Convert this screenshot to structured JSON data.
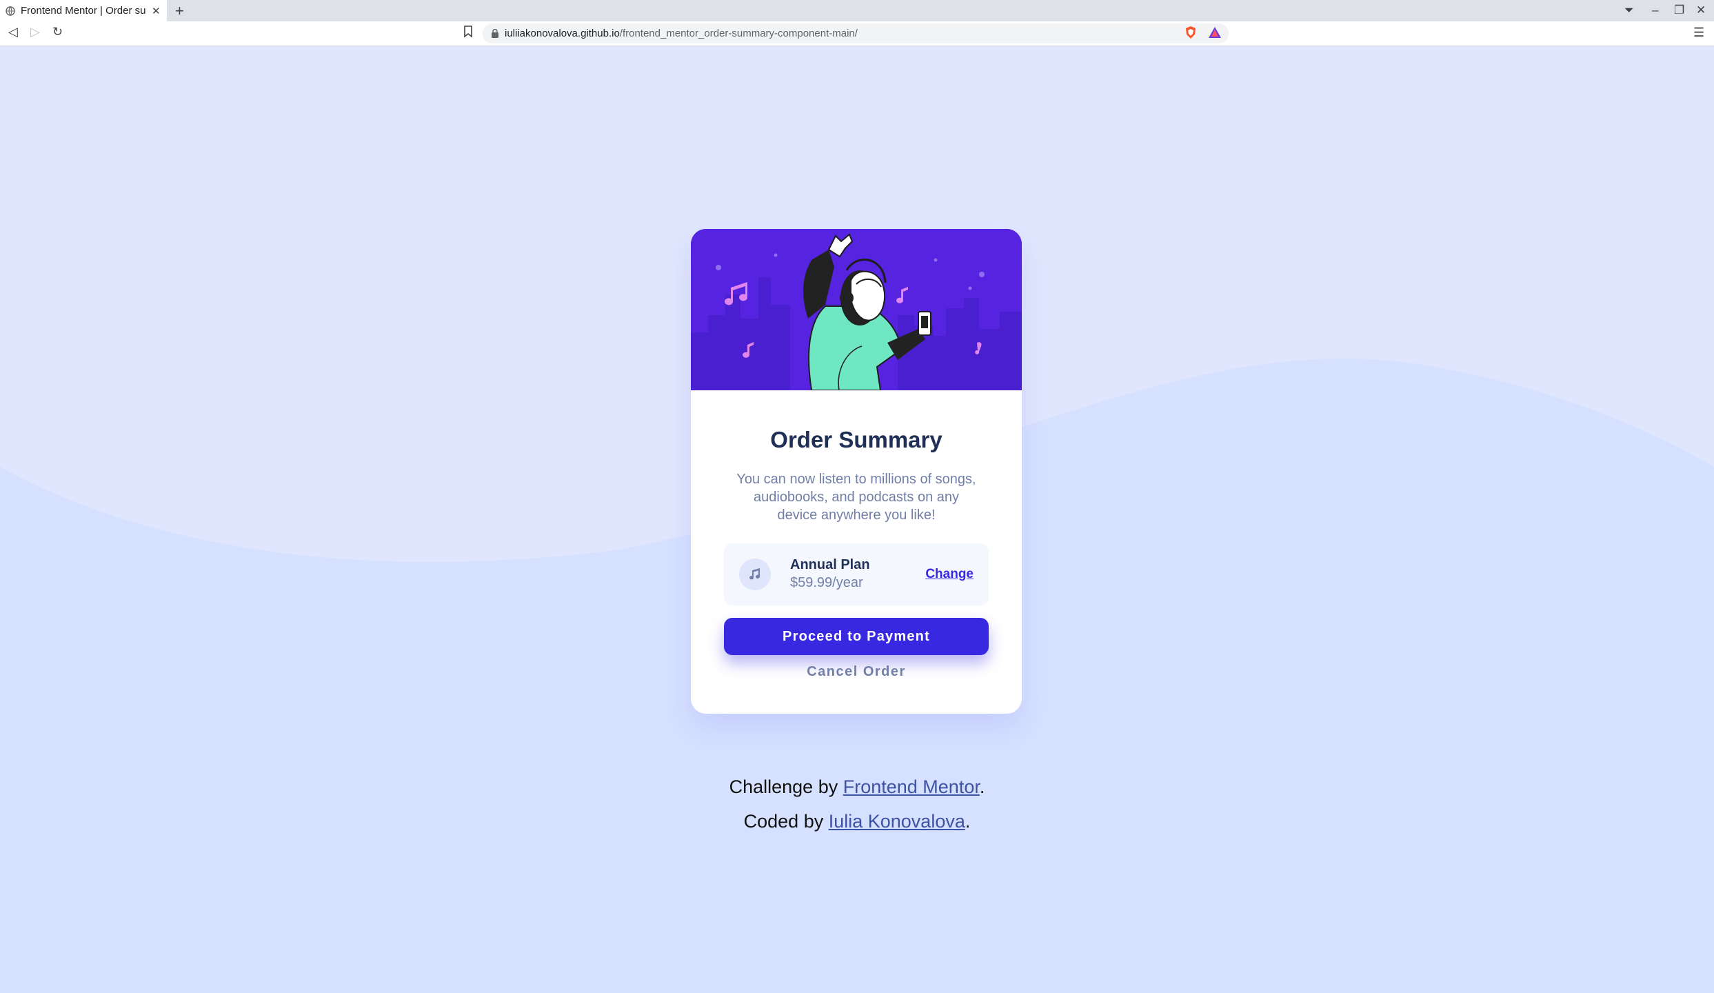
{
  "browser": {
    "tab_title": "Frontend Mentor | Order summary",
    "url_domain": "iuliiakonovalova.github.io",
    "url_path": "/frontend_mentor_order-summary-component-main/"
  },
  "card": {
    "title": "Order Summary",
    "description": "You can now listen to millions of songs, audiobooks, and podcasts on any device anywhere you like!",
    "plan": {
      "name": "Annual Plan",
      "price": "$59.99/year",
      "change_label": "Change"
    },
    "pay_label": "Proceed to Payment",
    "cancel_label": "Cancel Order"
  },
  "credits": {
    "challenge_prefix": "Challenge by ",
    "challenge_link": "Frontend Mentor",
    "coded_prefix": "Coded by ",
    "coded_link": "Iulia Konovalova",
    "period": "."
  },
  "colors": {
    "page_bg": "#e0e6fd",
    "wave": "#d6e1ff",
    "primary": "#3829e0",
    "hero": "#5624e0",
    "title": "#1f2f56",
    "text": "#717fa6",
    "accent_mint": "#6fe7c2"
  },
  "icons": {
    "tab": "globe-icon",
    "plan": "music-note-icon"
  }
}
